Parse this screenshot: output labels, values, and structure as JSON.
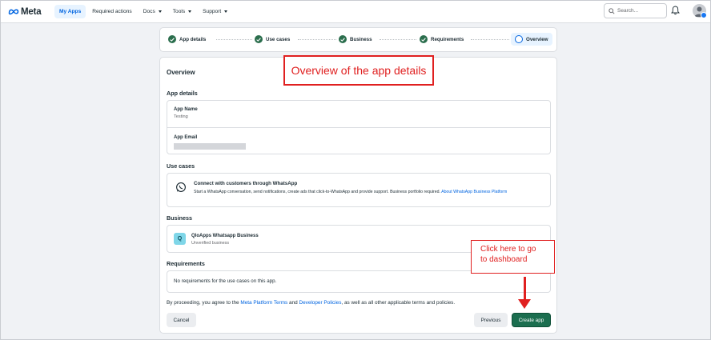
{
  "header": {
    "logo_text": "Meta",
    "nav": [
      {
        "label": "My Apps"
      },
      {
        "label": "Required actions"
      },
      {
        "label": "Docs"
      },
      {
        "label": "Tools"
      },
      {
        "label": "Support"
      }
    ],
    "search_placeholder": "Search..."
  },
  "stepper": {
    "steps": [
      {
        "label": "App details",
        "status": "complete"
      },
      {
        "label": "Use cases",
        "status": "complete"
      },
      {
        "label": "Business",
        "status": "complete"
      },
      {
        "label": "Requirements",
        "status": "complete"
      },
      {
        "label": "Overview",
        "status": "current"
      }
    ]
  },
  "overview": {
    "title": "Overview",
    "app_details": {
      "heading": "App details",
      "name_label": "App Name",
      "name_value": "Testing",
      "email_label": "App Email"
    },
    "use_cases": {
      "heading": "Use cases",
      "title": "Connect with customers through WhatsApp",
      "description": "Start a WhatsApp conversation, send notifications, create ads that click-to-WhatsApp and provide support. Business portfolio required.",
      "link": "About WhatsApp Business Platform"
    },
    "business": {
      "heading": "Business",
      "icon_letter": "Q",
      "name": "QloApps Whatsapp Business",
      "status": "Unverified business"
    },
    "requirements": {
      "heading": "Requirements",
      "text": "No requirements for the use cases on this app."
    },
    "terms": {
      "prefix": "By proceeding, you agree to the",
      "link1": "Meta Platform Terms",
      "middle": "and",
      "link2": "Developer Policies",
      "suffix": ", as well as all other applicable terms and policies."
    },
    "buttons": {
      "cancel": "Cancel",
      "previous": "Previous",
      "create": "Create app"
    }
  },
  "annotations": {
    "overview_note": "Overview of the app details",
    "dashboard_note_line1": "Click here to go",
    "dashboard_note_line2": "to dashboard"
  },
  "colors": {
    "accent": "#0064e0",
    "step_complete": "#2b6e4d",
    "create_button": "#1b6e4f",
    "annotation": "#e02020"
  }
}
